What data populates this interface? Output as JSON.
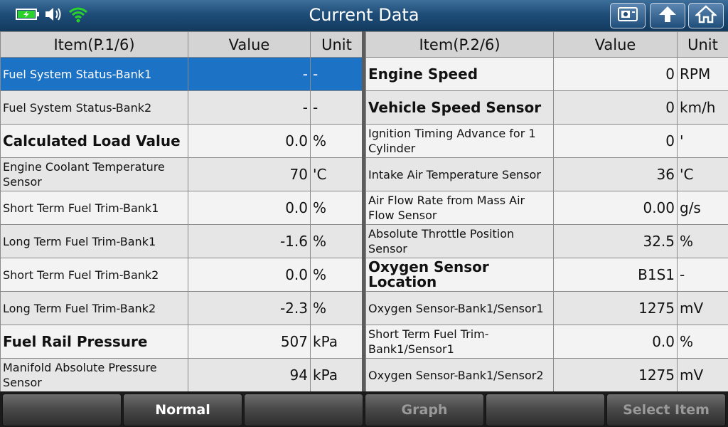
{
  "title": "Current Data",
  "status": {
    "battery_icon": "battery-charging-icon",
    "speaker_icon": "speaker-icon",
    "wifi_icon": "wifi-icon"
  },
  "toolbar": {
    "snapshot_icon": "snapshot-icon",
    "back_icon": "back-arrow-icon",
    "home_icon": "home-icon"
  },
  "left": {
    "headers": {
      "item": "Item(P.1/6)",
      "value": "Value",
      "unit": "Unit"
    },
    "rows": [
      {
        "item": "Fuel System Status-Bank1",
        "value": "-",
        "unit": "-"
      },
      {
        "item": "Fuel System Status-Bank2",
        "value": "-",
        "unit": "-"
      },
      {
        "item": "Calculated Load Value",
        "value": "0.0",
        "unit": "%"
      },
      {
        "item": "Engine Coolant Temperature Sensor",
        "value": "70",
        "unit": "'C"
      },
      {
        "item": "Short Term Fuel Trim-Bank1",
        "value": "0.0",
        "unit": "%"
      },
      {
        "item": "Long Term Fuel Trim-Bank1",
        "value": "-1.6",
        "unit": "%"
      },
      {
        "item": "Short Term Fuel Trim-Bank2",
        "value": "0.0",
        "unit": "%"
      },
      {
        "item": "Long Term Fuel Trim-Bank2",
        "value": "-2.3",
        "unit": "%"
      },
      {
        "item": "Fuel Rail Pressure",
        "value": "507",
        "unit": "kPa"
      },
      {
        "item": "Manifold Absolute Pressure Sensor",
        "value": "94",
        "unit": "kPa"
      }
    ]
  },
  "right": {
    "headers": {
      "item": "Item(P.2/6)",
      "value": "Value",
      "unit": "Unit"
    },
    "rows": [
      {
        "item": "Engine Speed",
        "value": "0",
        "unit": "RPM"
      },
      {
        "item": "Vehicle Speed Sensor",
        "value": "0",
        "unit": "km/h"
      },
      {
        "item": "Ignition Timing Advance for 1 Cylinder",
        "value": "0",
        "unit": "'"
      },
      {
        "item": "Intake Air Temperature Sensor",
        "value": "36",
        "unit": "'C"
      },
      {
        "item": "Air Flow Rate from Mass Air Flow Sensor",
        "value": "0.00",
        "unit": "g/s"
      },
      {
        "item": "Absolute Throttle Position Sensor",
        "value": "32.5",
        "unit": "%"
      },
      {
        "item": "Oxygen Sensor Location",
        "value": "B1S1",
        "unit": "-"
      },
      {
        "item": "Oxygen Sensor-Bank1/Sensor1",
        "value": "1275",
        "unit": "mV"
      },
      {
        "item": "Short Term Fuel Trim-Bank1/Sensor1",
        "value": "0.0",
        "unit": "%"
      },
      {
        "item": "Oxygen Sensor-Bank1/Sensor2",
        "value": "1275",
        "unit": "mV"
      }
    ]
  },
  "bottom": {
    "normal": "Normal",
    "graph": "Graph",
    "select_item": "Select Item"
  }
}
